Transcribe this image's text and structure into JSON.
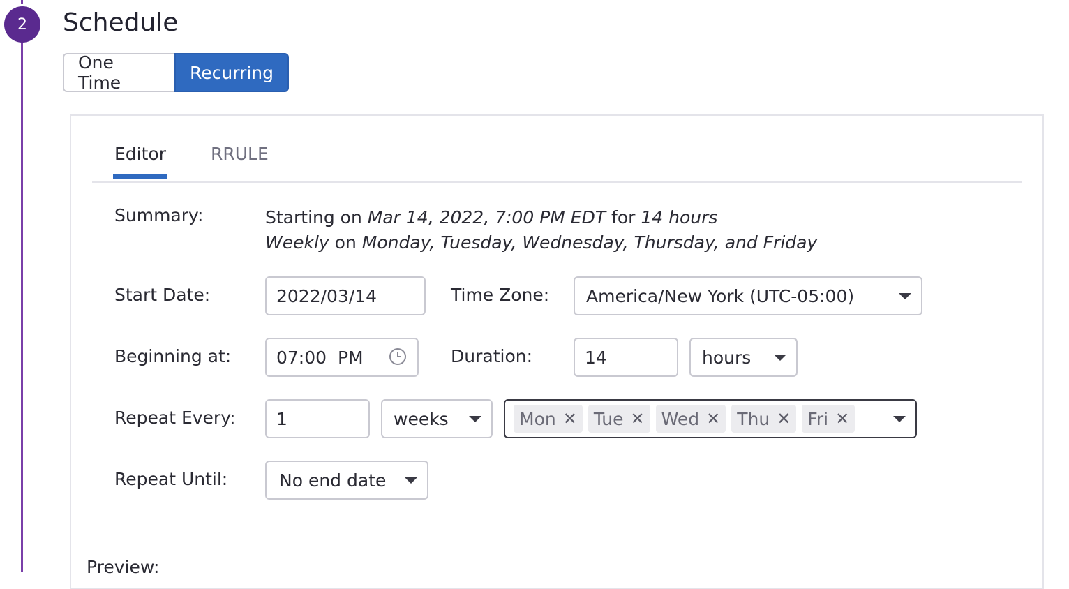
{
  "step": {
    "number": "2",
    "title": "Schedule"
  },
  "mode_toggle": {
    "one_time": "One Time",
    "recurring": "Recurring"
  },
  "tabs": {
    "editor": "Editor",
    "rrule": "RRULE"
  },
  "summary": {
    "label": "Summary:",
    "line1_prefix": "Starting on ",
    "line1_date": "Mar 14, 2022, 7:00 PM EDT",
    "line1_mid": " for ",
    "line1_duration": "14 hours",
    "line2_freq": "Weekly",
    "line2_mid": " on ",
    "line2_days": "Monday, Tuesday, Wednesday, Thursday, and Friday"
  },
  "start_date": {
    "label": "Start Date:",
    "value": "2022/03/14"
  },
  "time_zone": {
    "label": "Time Zone:",
    "value": "America/New York (UTC-05:00)"
  },
  "beginning_at": {
    "label": "Beginning at:",
    "value": "07:00  PM"
  },
  "duration": {
    "label": "Duration:",
    "value": "14",
    "unit": "hours"
  },
  "repeat_every": {
    "label": "Repeat Every:",
    "value": "1",
    "unit": "weeks",
    "days": [
      "Mon",
      "Tue",
      "Wed",
      "Thu",
      "Fri"
    ]
  },
  "repeat_until": {
    "label": "Repeat Until:",
    "value": "No end date"
  },
  "preview": {
    "label": "Preview:"
  },
  "colors": {
    "accent": "#2f6ac0",
    "step": "#5a2a8f",
    "step_line": "#7a3fa9"
  },
  "icons": {
    "clock": "clock-icon",
    "caret": "chevron-down-icon",
    "remove": "close-icon"
  }
}
